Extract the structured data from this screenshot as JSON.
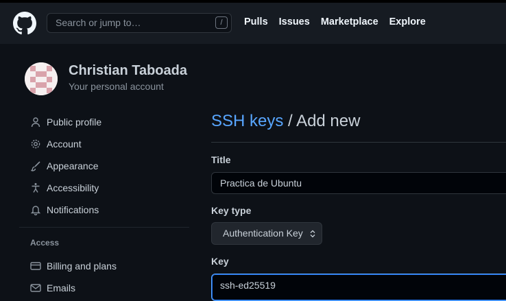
{
  "header": {
    "search_placeholder": "Search or jump to…",
    "search_shortcut": "/",
    "nav": [
      "Pulls",
      "Issues",
      "Marketplace",
      "Explore"
    ]
  },
  "account": {
    "name": "Christian Taboada",
    "subtitle": "Your personal account"
  },
  "sidebar": {
    "items": [
      {
        "label": "Public profile",
        "icon": "person-icon"
      },
      {
        "label": "Account",
        "icon": "gear-icon"
      },
      {
        "label": "Appearance",
        "icon": "paintbrush-icon"
      },
      {
        "label": "Accessibility",
        "icon": "accessibility-icon"
      },
      {
        "label": "Notifications",
        "icon": "bell-icon"
      }
    ],
    "access_heading": "Access",
    "access_items": [
      {
        "label": "Billing and plans",
        "icon": "credit-card-icon"
      },
      {
        "label": "Emails",
        "icon": "mail-icon"
      }
    ]
  },
  "main": {
    "heading_link": "SSH keys",
    "heading_sep": "/",
    "heading_rest": "Add new",
    "title_label": "Title",
    "title_value": "Practica de Ubuntu",
    "keytype_label": "Key type",
    "keytype_value": "Authentication Key",
    "key_label": "Key",
    "key_value": "ssh-ed25519"
  },
  "colors": {
    "background": "#0d1117",
    "header_bg": "#161b22",
    "accent_link": "#58a6ff",
    "text": "#c9d1d9",
    "muted": "#8b949e"
  }
}
